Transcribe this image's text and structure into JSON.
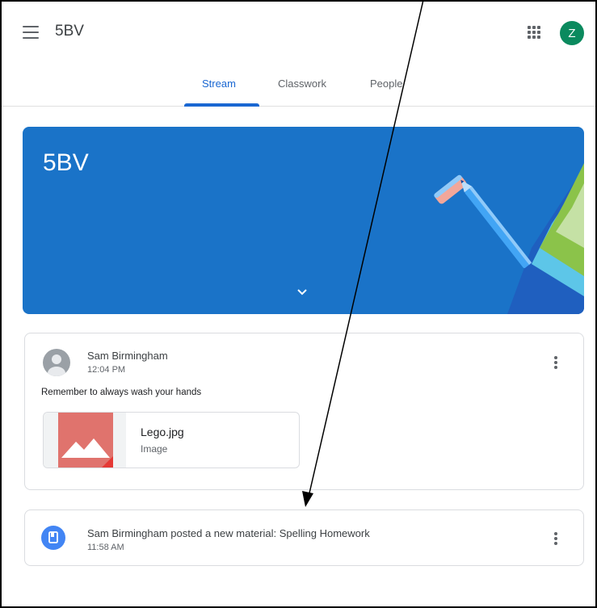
{
  "header": {
    "class_name": "5BV",
    "avatar_letter": "Z",
    "avatar_color": "#0b8a5e"
  },
  "tabs": [
    {
      "label": "Stream",
      "active": true
    },
    {
      "label": "Classwork",
      "active": false
    },
    {
      "label": "People",
      "active": false
    }
  ],
  "banner": {
    "title": "5BV",
    "color": "#1a73c8"
  },
  "post": {
    "author": "Sam Birmingham",
    "time": "12:04 PM",
    "text": "Remember to always wash your hands",
    "attachment": {
      "name": "Lego.jpg",
      "type": "Image",
      "icon": "image-icon"
    }
  },
  "material": {
    "title": "Sam Birmingham posted a new material: Spelling Homework",
    "time": "11:58 AM",
    "icon": "book-icon",
    "color": "#4285f4"
  },
  "colors": {
    "accent": "#1967d2",
    "text": "#3c4043",
    "muted": "#5f6368",
    "border": "#dadce0"
  }
}
